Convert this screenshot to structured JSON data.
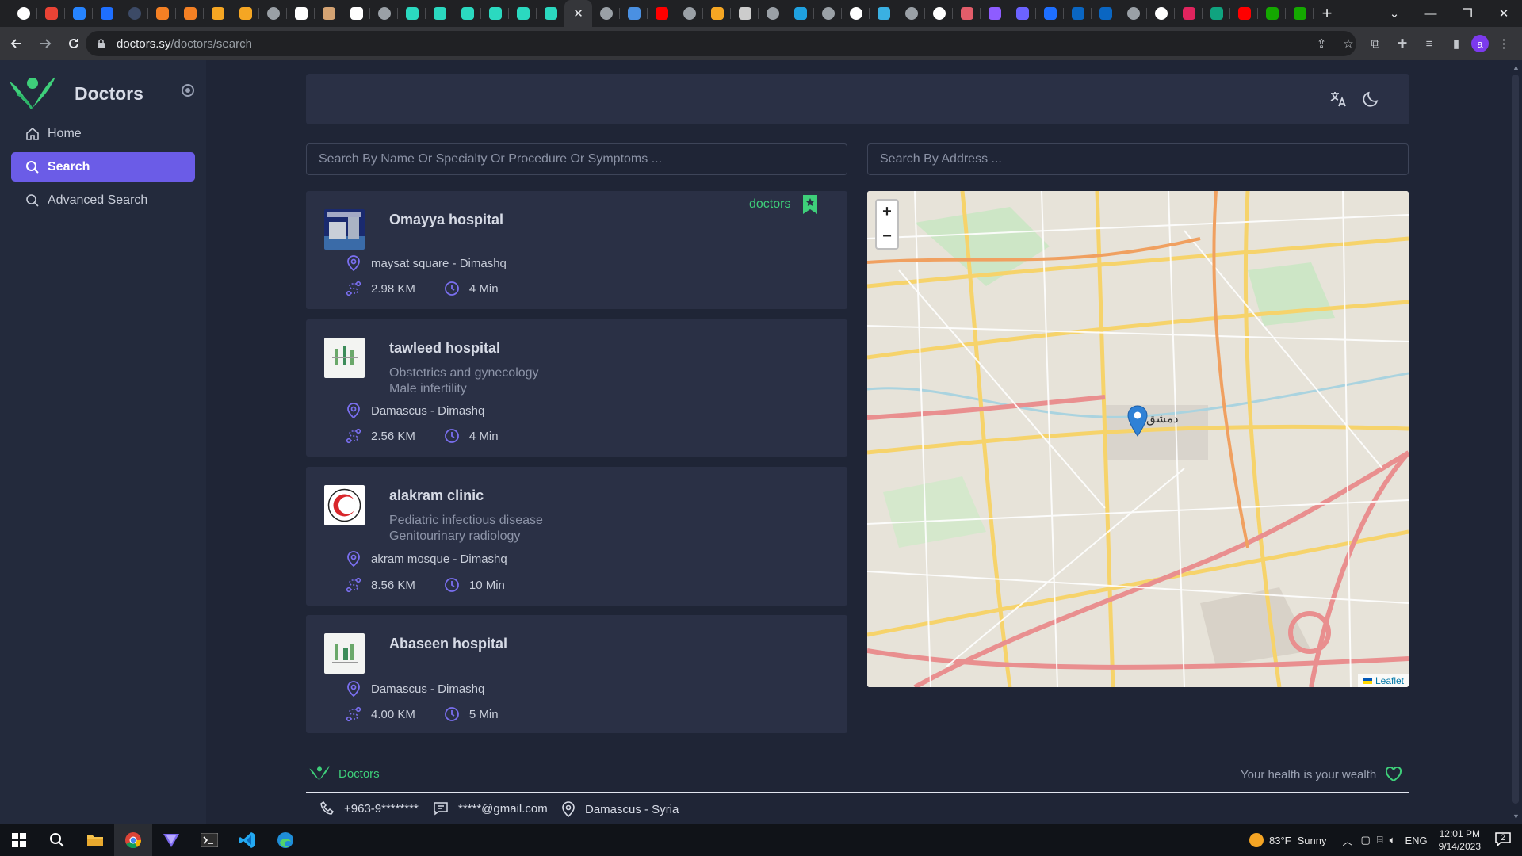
{
  "browser": {
    "tabs": [
      {
        "icon": "google-icon",
        "color": "#ffffff"
      },
      {
        "icon": "gmail-icon",
        "color": "#ea4335"
      },
      {
        "icon": "jira-icon",
        "color": "#2684ff"
      },
      {
        "icon": "trello-icon",
        "color": "#1e6fff"
      },
      {
        "icon": "circle-icon",
        "color": "#3c4a66"
      },
      {
        "icon": "stack-icon",
        "color": "#f48024"
      },
      {
        "icon": "stack-icon",
        "color": "#f48024"
      },
      {
        "icon": "infinity-icon",
        "color": "#f5a623"
      },
      {
        "icon": "bars-icon",
        "color": "#f5a623"
      },
      {
        "icon": "github-icon",
        "color": "#9aa0a6"
      },
      {
        "icon": "a-icon",
        "color": "#ffffff"
      },
      {
        "icon": "face-icon",
        "color": "#d4a373"
      },
      {
        "icon": "ad-icon",
        "color": "#ffffff"
      },
      {
        "icon": "github-icon",
        "color": "#9aa0a6"
      },
      {
        "icon": "wave-icon",
        "color": "#2bd9c0"
      },
      {
        "icon": "wave-icon",
        "color": "#2bd9c0"
      },
      {
        "icon": "wave-icon",
        "color": "#2bd9c0"
      },
      {
        "icon": "wave-icon",
        "color": "#2bd9c0"
      },
      {
        "icon": "wave-icon",
        "color": "#2bd9c0"
      },
      {
        "icon": "wave-icon",
        "color": "#2bd9c0"
      },
      {
        "icon": "close-icon",
        "color": "#e8eaed",
        "active": true
      },
      {
        "icon": "globe-icon",
        "color": "#9aa0a6"
      },
      {
        "icon": "chat-icon",
        "color": "#4a90e2"
      },
      {
        "icon": "youtube-icon",
        "color": "#ff0000"
      },
      {
        "icon": "globe-icon",
        "color": "#9aa0a6"
      },
      {
        "icon": "infinity-icon",
        "color": "#f5a623"
      },
      {
        "icon": "book-icon",
        "color": "#cccccc"
      },
      {
        "icon": "github-icon",
        "color": "#9aa0a6"
      },
      {
        "icon": "hand-icon",
        "color": "#1fa1e0"
      },
      {
        "icon": "globe-icon",
        "color": "#9aa0a6"
      },
      {
        "icon": "google-icon",
        "color": "#ffffff"
      },
      {
        "icon": "cube-icon",
        "color": "#3ab0e2"
      },
      {
        "icon": "github-icon",
        "color": "#9aa0a6"
      },
      {
        "icon": "google-icon",
        "color": "#ffffff"
      },
      {
        "icon": "d-icon",
        "color": "#e35d6a"
      },
      {
        "icon": "purple-icon",
        "color": "#8e5cff"
      },
      {
        "icon": "gear-icon",
        "color": "#6c63ff"
      },
      {
        "icon": "diamond-icon",
        "color": "#1e6fff"
      },
      {
        "icon": "linkedin-icon",
        "color": "#0a66c2"
      },
      {
        "icon": "linkedin-icon",
        "color": "#0a66c2"
      },
      {
        "icon": "github-icon",
        "color": "#9aa0a6"
      },
      {
        "icon": "google-icon",
        "color": "#ffffff"
      },
      {
        "icon": "pink-icon",
        "color": "#e0245e"
      },
      {
        "icon": "gpt-icon",
        "color": "#10a37f"
      },
      {
        "icon": "youtube-icon",
        "color": "#ff0000"
      },
      {
        "icon": "upwork-icon",
        "color": "#14a800"
      },
      {
        "icon": "upwork-icon",
        "color": "#14a800"
      }
    ],
    "url_host": "doctors.sy",
    "url_path": "/doctors/search",
    "profile_initial": "a"
  },
  "sidebar": {
    "brand": "Doctors",
    "items": [
      {
        "label": "Home",
        "icon": "home-icon",
        "active": false
      },
      {
        "label": "Search",
        "icon": "search-icon",
        "active": true
      },
      {
        "label": "Advanced Search",
        "icon": "search-icon",
        "active": false
      }
    ]
  },
  "search": {
    "name_placeholder": "Search By Name Or Specialty Or Procedure Or Symptoms ...",
    "address_placeholder": "Search By Address ..."
  },
  "results_tag": "doctors",
  "results": [
    {
      "name": "Omayya hospital",
      "specialties": [],
      "address": "maysat square - Dimashq",
      "distance": "2.98 KM",
      "time": "4 Min"
    },
    {
      "name": "tawleed hospital",
      "specialties": [
        "Obstetrics and gynecology",
        "Male infertility"
      ],
      "address": "Damascus - Dimashq",
      "distance": "2.56 KM",
      "time": "4 Min"
    },
    {
      "name": "alakram clinic",
      "specialties": [
        "Pediatric infectious disease",
        "Genitourinary radiology"
      ],
      "address": "akram mosque - Dimashq",
      "distance": "8.56 KM",
      "time": "10 Min"
    },
    {
      "name": "Abaseen hospital",
      "specialties": [],
      "address": "Damascus - Dimashq",
      "distance": "4.00 KM",
      "time": "5 Min"
    }
  ],
  "map": {
    "zoom_in": "+",
    "zoom_out": "−",
    "attribution": "Leaflet",
    "city_label": "دمشق"
  },
  "footer": {
    "brand": "Doctors",
    "slogan": "Your health is your wealth",
    "phone": "+963-9********",
    "email": "*****@gmail.com",
    "location": "Damascus - Syria"
  },
  "taskbar": {
    "weather_temp": "83°F",
    "weather_text": "Sunny",
    "language": "ENG",
    "time": "12:01 PM",
    "date": "9/14/2023",
    "notifications": "2"
  },
  "colors": {
    "accent": "#6b5ce7",
    "brand_green": "#3ecf7a",
    "card_bg": "#2a3045",
    "page_bg": "#1f2536"
  }
}
